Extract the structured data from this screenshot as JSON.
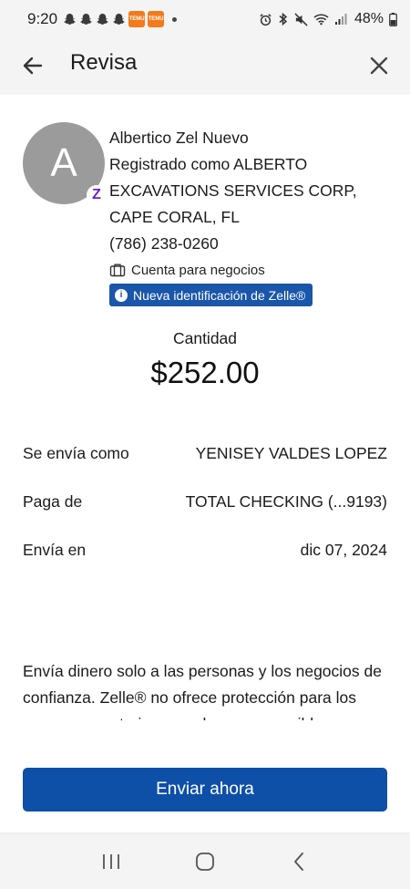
{
  "status_bar": {
    "time": "9:20",
    "temu_label": "TEMU",
    "battery": "48%"
  },
  "header": {
    "title": "Revisa",
    "back_icon": "arrow-left-icon",
    "close_icon": "close-icon"
  },
  "recipient": {
    "avatar_initial": "A",
    "zelle_badge_glyph": "Z",
    "name": "Albertico Zel Nuevo",
    "registered_line1": "Registrado como ALBERTO",
    "registered_line2": "EXCAVATIONS SERVICES CORP,",
    "location": "CAPE CORAL, FL",
    "phone": "(786) 238-0260",
    "account_type": "Cuenta para negocios",
    "id_badge": "Nueva identificación de Zelle®",
    "id_badge_info_glyph": "i"
  },
  "amount": {
    "label": "Cantidad",
    "value": "$252.00"
  },
  "details": [
    {
      "label": "Se envía como",
      "value": "YENISEY VALDES LOPEZ"
    },
    {
      "label": "Paga de",
      "value": "TOTAL CHECKING (...9193)"
    },
    {
      "label": "Envía en",
      "value": "dic 07, 2024"
    }
  ],
  "disclaimer": "Envía dinero solo a las personas y los negocios de confianza. Zelle® no ofrece protección para los pagos que autorices, por lo que es posible",
  "primary_button": "Enviar ahora",
  "colors": {
    "primary": "#0e4fa8",
    "badge": "#1a56a9",
    "zelle_purple": "#6d1ed4",
    "avatar": "#9b9b9b"
  }
}
